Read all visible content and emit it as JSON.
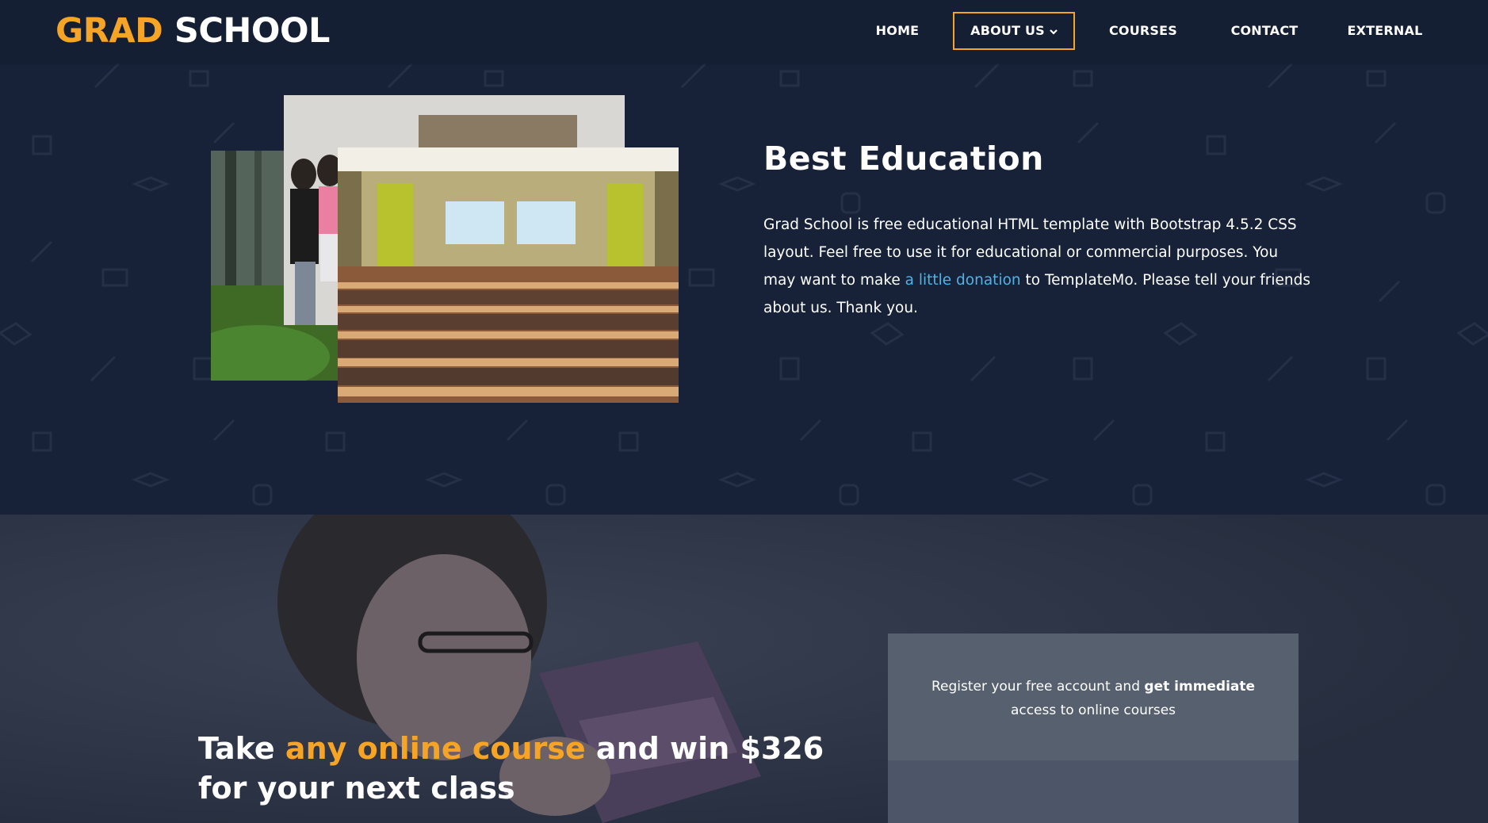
{
  "logo": {
    "part1": "GRAD",
    "part2": "SCHOOL"
  },
  "nav": {
    "items": [
      {
        "label": "HOME"
      },
      {
        "label": "ABOUT US"
      },
      {
        "label": "COURSES"
      },
      {
        "label": "CONTACT"
      },
      {
        "label": "EXTERNAL"
      }
    ],
    "active_item": "ABOUT US"
  },
  "about": {
    "title": "Best Education",
    "text_before": "Grad School is free educational HTML template with Bootstrap 4.5.2 CSS layout. Feel free to use it for educational or commercial purposes. You may want to make ",
    "link": "a little donation",
    "text_after": " to TemplateMo. Please tell your friends about us. Thank you."
  },
  "promo": {
    "part1": "Take ",
    "highlight": "any online course",
    "part2": " and win $326",
    "line2": "for your next class"
  },
  "register": {
    "text_before": "Register your free account and ",
    "bold": "get immediate",
    "text_after": "access to online courses"
  },
  "colors": {
    "accent": "#f5a425",
    "link": "#4fb3e6",
    "top_background": "#172238",
    "bottom_background": "#2b3447"
  }
}
